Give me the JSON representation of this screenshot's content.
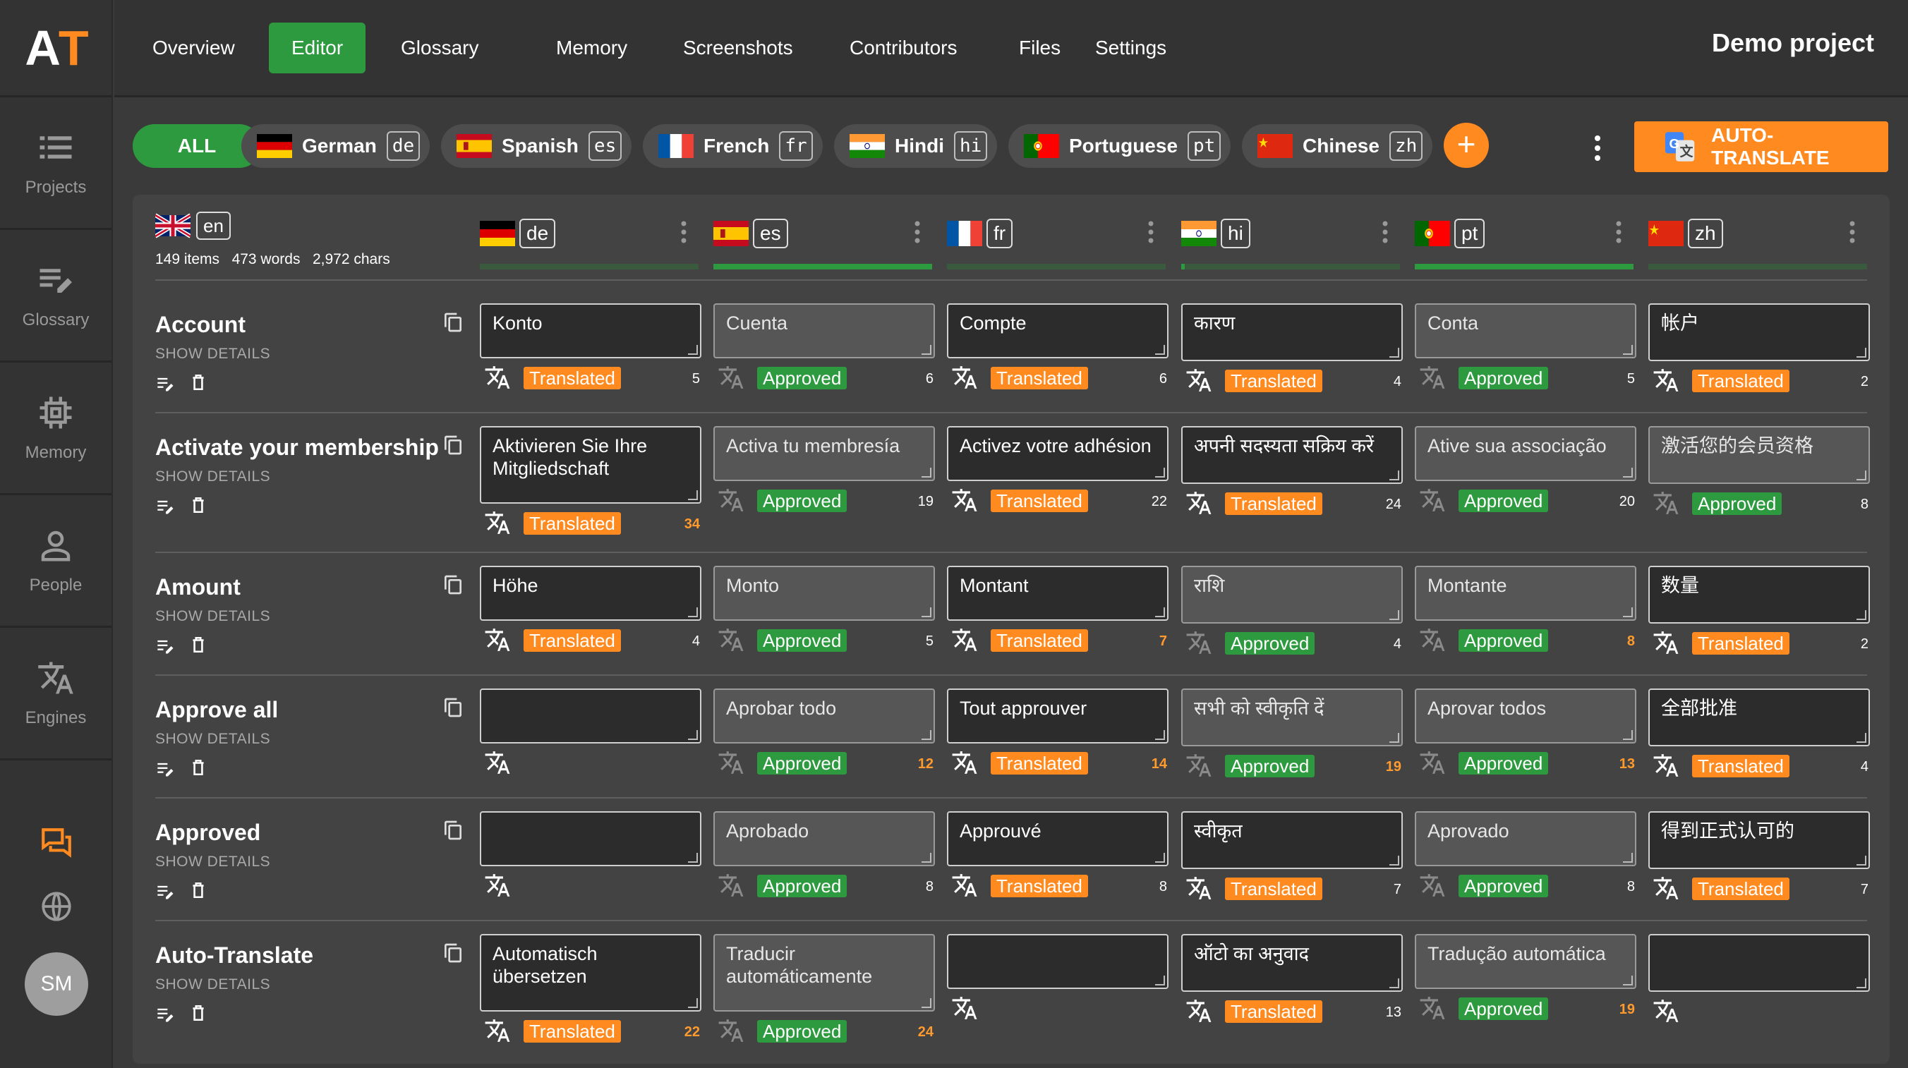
{
  "app": {
    "logo_a": "A",
    "logo_t": "T",
    "project": "Demo project"
  },
  "sidebar": [
    {
      "label": "Projects",
      "icon": "list-icon"
    },
    {
      "label": "Glossary",
      "icon": "glossary-edit-icon"
    },
    {
      "label": "Memory",
      "icon": "memory-chip-icon"
    },
    {
      "label": "People",
      "icon": "person-icon"
    },
    {
      "label": "Engines",
      "icon": "translate-icon"
    }
  ],
  "avatar": "SM",
  "nav": [
    "Overview",
    "Editor",
    "Glossary",
    "Memory",
    "Screenshots",
    "Contributors",
    "Files",
    "Settings"
  ],
  "nav_active": "Editor",
  "filters": {
    "all": "ALL",
    "langs": [
      {
        "name": "German",
        "code": "de"
      },
      {
        "name": "Spanish",
        "code": "es"
      },
      {
        "name": "French",
        "code": "fr"
      },
      {
        "name": "Hindi",
        "code": "hi"
      },
      {
        "name": "Portuguese",
        "code": "pt"
      },
      {
        "name": "Chinese",
        "code": "zh"
      }
    ]
  },
  "add": "+",
  "auto_translate": "AUTO-TRANSLATE",
  "source": {
    "code": "en",
    "items": "149 items",
    "words": "473 words",
    "chars": "2,972 chars"
  },
  "columns": [
    {
      "code": "de",
      "progress": 0.0
    },
    {
      "code": "es",
      "progress": 1.0
    },
    {
      "code": "fr",
      "progress": 0.0
    },
    {
      "code": "hi",
      "progress": 0.01
    },
    {
      "code": "pt",
      "progress": 1.0
    },
    {
      "code": "zh",
      "progress": 0.0
    }
  ],
  "show_details": "SHOW DETAILS",
  "labels": {
    "translated": "Translated",
    "approved": "Approved"
  },
  "rows": [
    {
      "key": "Account",
      "cells": [
        {
          "text": "Konto",
          "status": "Translated",
          "count": "5"
        },
        {
          "text": "Cuenta",
          "status": "Approved",
          "count": "6"
        },
        {
          "text": "Compte",
          "status": "Translated",
          "count": "6"
        },
        {
          "text": "कारण",
          "status": "Translated",
          "count": "4"
        },
        {
          "text": "Conta",
          "status": "Approved",
          "count": "5"
        },
        {
          "text": "帐户",
          "status": "Translated",
          "count": "2"
        }
      ]
    },
    {
      "key": "Activate your membership",
      "cells": [
        {
          "text": "Aktivieren Sie Ihre Mitgliedschaft",
          "status": "Translated",
          "count": "34"
        },
        {
          "text": "Activa tu membresía",
          "status": "Approved",
          "count": "19"
        },
        {
          "text": "Activez votre adhésion",
          "status": "Translated",
          "count": "22"
        },
        {
          "text": "अपनी सदस्यता सक्रिय करें",
          "status": "Translated",
          "count": "24"
        },
        {
          "text": "Ative sua associação",
          "status": "Approved",
          "count": "20"
        },
        {
          "text": "激活您的会员资格",
          "status": "Approved",
          "count": "8"
        }
      ]
    },
    {
      "key": "Amount",
      "cells": [
        {
          "text": "Höhe",
          "status": "Translated",
          "count": "4"
        },
        {
          "text": "Monto",
          "status": "Approved",
          "count": "5"
        },
        {
          "text": "Montant",
          "status": "Translated",
          "count": "7"
        },
        {
          "text": "राशि",
          "status": "Approved",
          "count": "4"
        },
        {
          "text": "Montante",
          "status": "Approved",
          "count": "8"
        },
        {
          "text": "数量",
          "status": "Translated",
          "count": "2"
        }
      ]
    },
    {
      "key": "Approve all",
      "cells": [
        {
          "text": "",
          "status": "",
          "count": ""
        },
        {
          "text": "Aprobar todo",
          "status": "Approved",
          "count": "12"
        },
        {
          "text": "Tout approuver",
          "status": "Translated",
          "count": "14"
        },
        {
          "text": "सभी को स्वीकृति दें",
          "status": "Approved",
          "count": "19"
        },
        {
          "text": "Aprovar todos",
          "status": "Approved",
          "count": "13"
        },
        {
          "text": "全部批准",
          "status": "Translated",
          "count": "4"
        }
      ]
    },
    {
      "key": "Approved",
      "cells": [
        {
          "text": "",
          "status": "",
          "count": ""
        },
        {
          "text": "Aprobado",
          "status": "Approved",
          "count": "8"
        },
        {
          "text": "Approuvé",
          "status": "Translated",
          "count": "8"
        },
        {
          "text": "स्वीकृत",
          "status": "Translated",
          "count": "7"
        },
        {
          "text": "Aprovado",
          "status": "Approved",
          "count": "8"
        },
        {
          "text": "得到正式认可的",
          "status": "Translated",
          "count": "7"
        }
      ]
    },
    {
      "key": "Auto-Translate",
      "cells": [
        {
          "text": "Automatisch übersetzen",
          "status": "Translated",
          "count": "22"
        },
        {
          "text": "Traducir automáticamente",
          "status": "Approved",
          "count": "24"
        },
        {
          "text": "",
          "status": "",
          "count": ""
        },
        {
          "text": "ऑटो का अनुवाद",
          "status": "Translated",
          "count": "13"
        },
        {
          "text": "Tradução automática",
          "status": "Approved",
          "count": "19"
        },
        {
          "text": "",
          "status": "",
          "count": ""
        }
      ]
    }
  ]
}
